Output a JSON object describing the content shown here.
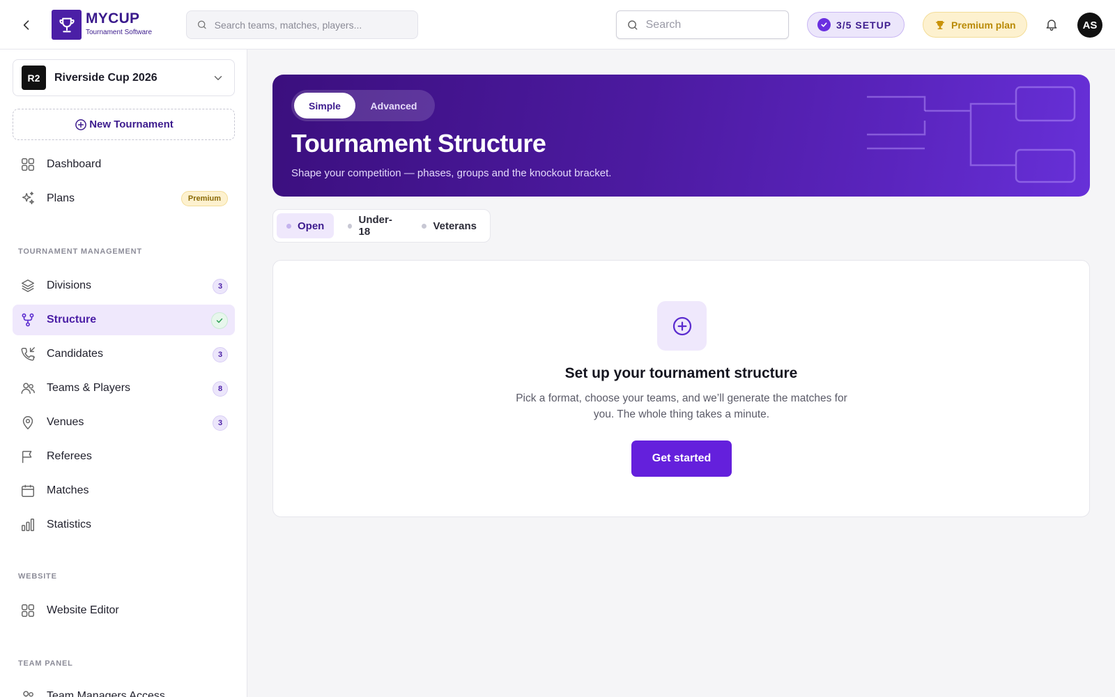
{
  "header": {
    "logo_name": "MYCUP",
    "logo_sub": "Tournament Software",
    "main_search_placeholder": "Search teams, matches, players...",
    "small_search_placeholder": "Search",
    "setup_label": "3/5  SETUP",
    "premium_label": "Premium plan",
    "avatar_initials": "AS"
  },
  "sidebar": {
    "tournament": {
      "badge": "R2",
      "name": "Riverside Cup 2026"
    },
    "new_tournament_label": "New Tournament",
    "top_items": [
      {
        "label": "Dashboard",
        "icon": "grid-icon"
      },
      {
        "label": "Plans",
        "icon": "sparkles-icon",
        "badge": "Premium"
      }
    ],
    "sections": [
      {
        "title": "TOURNAMENT MANAGEMENT",
        "items": [
          {
            "label": "Divisions",
            "icon": "layers-icon",
            "count": "3"
          },
          {
            "label": "Structure",
            "icon": "branch-icon",
            "active": true,
            "status": "done"
          },
          {
            "label": "Candidates",
            "icon": "phone-incoming-icon",
            "count": "3"
          },
          {
            "label": "Teams & Players",
            "icon": "users-icon",
            "count": "8"
          },
          {
            "label": "Venues",
            "icon": "map-pin-icon",
            "count": "3"
          },
          {
            "label": "Referees",
            "icon": "flag-icon"
          },
          {
            "label": "Matches",
            "icon": "calendar-icon"
          },
          {
            "label": "Statistics",
            "icon": "bar-chart-icon"
          }
        ]
      },
      {
        "title": "WEBSITE",
        "items": [
          {
            "label": "Website Editor",
            "icon": "grid-icon"
          }
        ]
      },
      {
        "title": "TEAM PANEL",
        "items": [
          {
            "label": "Team Managers Access",
            "icon": "users-icon"
          }
        ]
      }
    ]
  },
  "hero": {
    "toggle_options": [
      "Simple",
      "Advanced"
    ],
    "selected_toggle": "Simple",
    "title": "Tournament Structure",
    "subtitle": "Shape your competition — phases, groups and the knockout bracket."
  },
  "division_tabs": [
    {
      "label": "Open",
      "selected": true
    },
    {
      "label": "Under-18"
    },
    {
      "label": "Veterans"
    }
  ],
  "empty_state": {
    "icon": "plus-circle-icon",
    "title": "Set up your tournament structure",
    "description": "Pick a format, choose your teams, and we’ll generate the matches for you. The whole thing takes a minute.",
    "button_label": "Get started"
  },
  "colors": {
    "brand": "#4b1fa6",
    "accent": "#6420dc",
    "premium": "#b98a06",
    "success": "#2f9e56"
  }
}
